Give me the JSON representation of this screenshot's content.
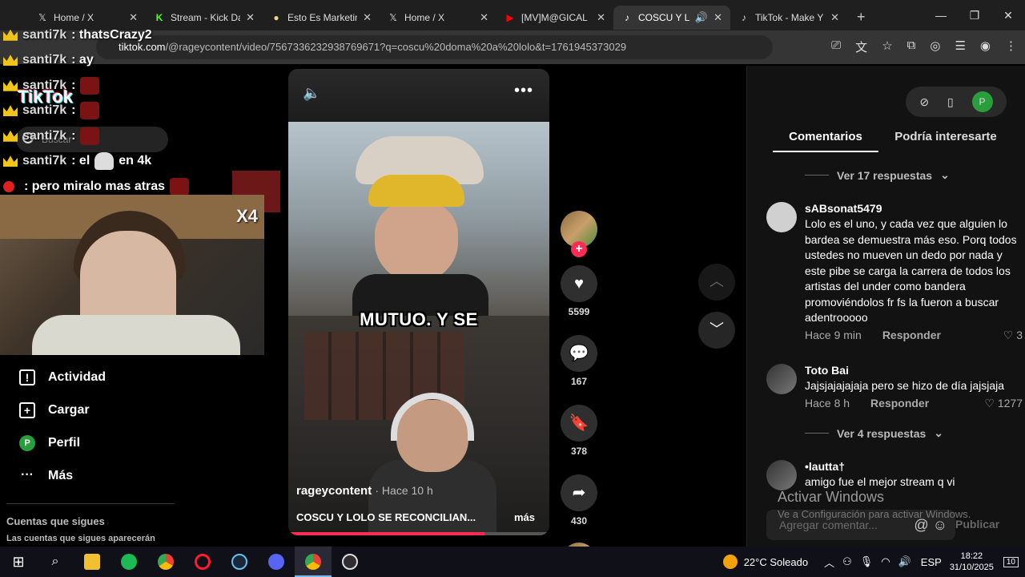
{
  "browser": {
    "tabs": [
      {
        "title": "Home / X",
        "icon": "𝕏",
        "active": false
      },
      {
        "title": "Stream - Kick Da",
        "icon": "K",
        "active": false
      },
      {
        "title": "Esto Es Marketin",
        "icon": "●",
        "active": false
      },
      {
        "title": "Home / X",
        "icon": "𝕏",
        "active": false
      },
      {
        "title": "[MV]M@GICAL",
        "icon": "▶",
        "active": false
      },
      {
        "title": "COSCU Y LO",
        "icon": "♪",
        "active": true
      },
      {
        "title": "TikTok - Make Y",
        "icon": "♪",
        "active": false
      }
    ],
    "url_host": "tiktok.com",
    "url_path": "/@rageycontent/video/7567336232938769671?q=coscu%20doma%20a%20lolo&t=1761945373029"
  },
  "stream_overlay": {
    "chat": [
      {
        "user": "santi7k",
        "text": ": thatsCrazy2"
      },
      {
        "user": "santi7k",
        "text": ": ay"
      },
      {
        "user": "santi7k",
        "text": ":"
      },
      {
        "user": "santi7k",
        "text": ":"
      },
      {
        "user": "santi7k",
        "text": ":"
      },
      {
        "user": "santi7k",
        "text": ": el",
        "suffix": "en 4k"
      },
      {
        "user": "",
        "text": ": pero miralo mas atras"
      }
    ],
    "cam_badge": "X4"
  },
  "tiktok_nav": {
    "logo": "TikTok",
    "search_placeholder": "Buscar",
    "items": [
      {
        "label": "Actividad",
        "icon": "!"
      },
      {
        "label": "Cargar",
        "icon": "+"
      },
      {
        "label": "Perfil",
        "icon": "P"
      },
      {
        "label": "Más",
        "icon": "···"
      }
    ],
    "following_title": "Cuentas que sigues",
    "following_sub": "Las cuentas que sigues aparecerán"
  },
  "video": {
    "caption": "MUTUO. Y SE",
    "author": "rageycontent",
    "posted": "· Hace 10 h",
    "description": "COSCU Y LOLO SE RECONCILIAN...",
    "more": "más",
    "progress": 0.75
  },
  "actions": {
    "likes": "5599",
    "comments": "167",
    "saves": "378",
    "shares": "430"
  },
  "panel": {
    "tabs": [
      "Comentarios",
      "Podría interesarte"
    ],
    "top_avatar": "P",
    "replies_1": "Ver 17 respuestas",
    "replies_2": "Ver 4 respuestas",
    "comments": [
      {
        "user": "sABsonat5479",
        "text": "Lolo es el uno, y cada vez que alguien lo bardea se demuestra más eso. Porq todos ustedes no mueven un dedo por nada y este pibe se carga la carrera de todos los artistas del under como bandera promoviéndolos fr fs la fueron a buscar adentrooooo",
        "time": "Hace 9 min",
        "reply": "Responder",
        "likes": "3"
      },
      {
        "user": "Toto Bai",
        "text": "Jajsjajajajaja pero se hizo de día jajsjaja",
        "time": "Hace 8 h",
        "reply": "Responder",
        "likes": "1277"
      },
      {
        "user": "•lautta†",
        "text": "amigo fue el mejor stream q vi"
      }
    ],
    "watermark": "Activar Windows",
    "watermark_sub": "Ve a Configuración para activar Windows.",
    "add_comment_placeholder": "Agregar comentar...",
    "publish": "Publicar"
  },
  "taskbar": {
    "weather": "22°C  Soleado",
    "lang": "ESP",
    "time": "18:22",
    "date": "31/10/2025",
    "notifications": "10"
  },
  "colors": {
    "accent": "#fe2c55",
    "panel_bg": "#121212",
    "taskbar_bg": "#101018"
  }
}
